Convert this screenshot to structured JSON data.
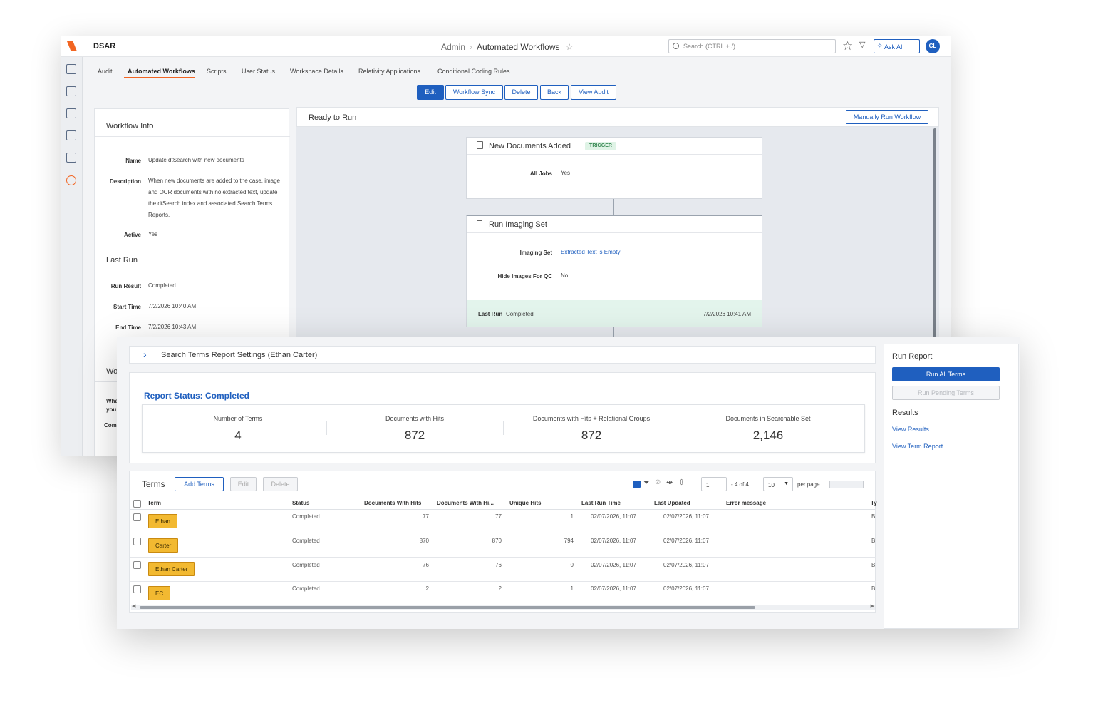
{
  "header": {
    "app_title": "DSAR",
    "breadcrumb": [
      "Admin",
      "Automated Workflows"
    ],
    "search_placeholder": "Search (CTRL + /)",
    "ask_ai": "Ask AI",
    "avatar": "CL"
  },
  "tabs": [
    "Audit",
    "Automated Workflows",
    "Scripts",
    "User Status",
    "Workspace Details",
    "Relativity Applications",
    "Conditional Coding Rules"
  ],
  "toolbar": {
    "edit": "Edit",
    "workflow_sync": "Workflow Sync",
    "delete": "Delete",
    "back": "Back",
    "view_audit": "View Audit"
  },
  "workflow_info": {
    "title": "Workflow Info",
    "name_label": "Name",
    "name": "Update dtSearch with new documents",
    "description_label": "Description",
    "description": "When new documents are added to the case, image and OCR documents with no extracted text, update the dtSearch index and associated Search Terms Reports.",
    "active_label": "Active",
    "active": "Yes"
  },
  "last_run": {
    "title": "Last Run",
    "result_label": "Run Result",
    "result": "Completed",
    "start_label": "Start Time",
    "start": "7/2/2026 10:40 AM",
    "end_label": "End Time",
    "end": "7/2/2026 10:43 AM"
  },
  "hidden_panel": {
    "title": "Wo",
    "line1": "Wha",
    "line2": "you",
    "line3": "Com"
  },
  "canvas": {
    "status": "Ready to Run",
    "manual_run": "Manually Run Workflow",
    "trigger_node": {
      "title": "New Documents Added",
      "badge": "TRIGGER",
      "label": "All Jobs",
      "value": "Yes"
    },
    "imaging_node": {
      "title": "Run Imaging Set",
      "set_label": "Imaging Set",
      "set_value": "Extracted Text is Empty",
      "hide_label": "Hide Images For QC",
      "hide_value": "No",
      "last_run_label": "Last Run",
      "last_run_value": "Completed",
      "last_run_time": "7/2/2026 10:41 AM"
    }
  },
  "report": {
    "settings_title": "Search Terms Report Settings (Ethan Carter)",
    "status": "Report Status: Completed",
    "stats": [
      {
        "label": "Number of Terms",
        "value": "4"
      },
      {
        "label": "Documents with Hits",
        "value": "872"
      },
      {
        "label": "Documents with Hits + Relational Groups",
        "value": "872"
      },
      {
        "label": "Documents in Searchable Set",
        "value": "2,146"
      }
    ]
  },
  "terms": {
    "title": "Terms",
    "add": "Add Terms",
    "edit": "Edit",
    "delete": "Delete",
    "page": "1",
    "page_of": "- 4 of 4",
    "per_page_value": "10",
    "per_page": "per page",
    "columns": [
      "Term",
      "Status",
      "Documents With Hits",
      "Documents With Hi...",
      "Unique Hits",
      "Last Run Time",
      "Last Updated",
      "Error message",
      "Ty"
    ],
    "rows": [
      {
        "term": "Ethan",
        "status": "Completed",
        "docs": "77",
        "docs2": "77",
        "unique": "1",
        "last_run": "02/07/2026, 11:07",
        "updated": "02/07/2026, 11:07",
        "error": "",
        "type": "B"
      },
      {
        "term": "Carter",
        "status": "Completed",
        "docs": "870",
        "docs2": "870",
        "unique": "794",
        "last_run": "02/07/2026, 11:07",
        "updated": "02/07/2026, 11:07",
        "error": "",
        "type": "B"
      },
      {
        "term": "Ethan Carter",
        "status": "Completed",
        "docs": "76",
        "docs2": "76",
        "unique": "0",
        "last_run": "02/07/2026, 11:07",
        "updated": "02/07/2026, 11:07",
        "error": "",
        "type": "B"
      },
      {
        "term": "EC",
        "status": "Completed",
        "docs": "2",
        "docs2": "2",
        "unique": "1",
        "last_run": "02/07/2026, 11:07",
        "updated": "02/07/2026, 11:07",
        "error": "",
        "type": "B"
      }
    ]
  },
  "side": {
    "run_report": "Run Report",
    "run_all": "Run All Terms",
    "run_pending": "Run Pending Terms",
    "results": "Results",
    "view_results": "View Results",
    "view_term_report": "View Term Report"
  },
  "colors": {
    "accent": "#1f5fbf",
    "brand": "#f26522",
    "highlight": "#f2b931",
    "success_bg": "#e3f4ec"
  }
}
